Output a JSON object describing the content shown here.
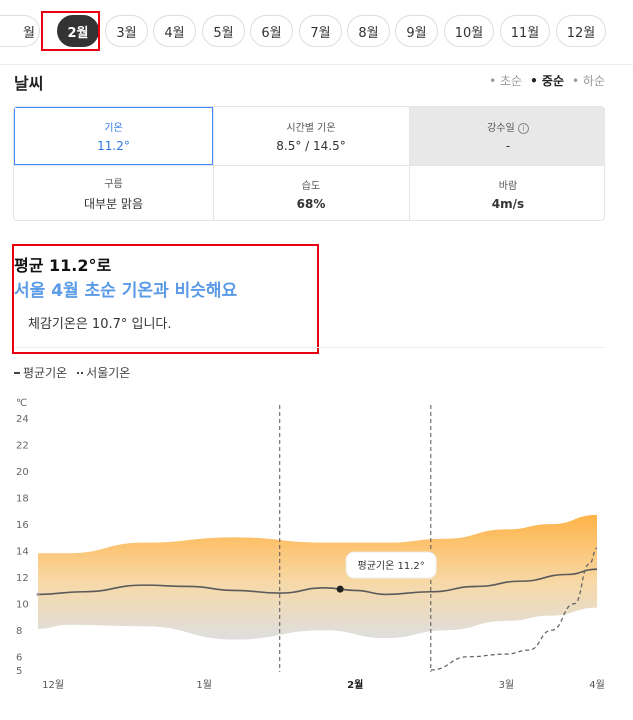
{
  "months": [
    {
      "label": "월",
      "active": false
    },
    {
      "label": "2월",
      "active": true
    },
    {
      "label": "3월",
      "active": false
    },
    {
      "label": "4월",
      "active": false
    },
    {
      "label": "5월",
      "active": false
    },
    {
      "label": "6월",
      "active": false
    },
    {
      "label": "7월",
      "active": false
    },
    {
      "label": "8월",
      "active": false
    },
    {
      "label": "9월",
      "active": false
    },
    {
      "label": "10월",
      "active": false
    },
    {
      "label": "11월",
      "active": false
    },
    {
      "label": "12월",
      "active": false
    }
  ],
  "section_title": "날씨",
  "time_filter": {
    "early": "• 초순",
    "mid": "• 중순",
    "late": "• 하순",
    "selected": "mid"
  },
  "weather": {
    "temp": {
      "label": "기온",
      "value": "11.2°"
    },
    "hourly": {
      "label": "시간별 기온",
      "value": "8.5° / 14.5°"
    },
    "rain_days": {
      "label": "강수일",
      "value": "-"
    },
    "cloud": {
      "label": "구름",
      "value": "대부분 맑음"
    },
    "humidity": {
      "label": "습도",
      "value": "68%"
    },
    "wind": {
      "label": "바람",
      "value": "4m/s"
    }
  },
  "summary": {
    "line1": "평균 11.2°로",
    "line2": "서울 4월 초순 기온과 비슷해요",
    "line3": "체감기온은 10.7° 입니다."
  },
  "legend": {
    "avg": "평균기온",
    "seoul": "서울기온"
  },
  "colors": {
    "accent": "#2e7ae5",
    "highlight_text": "#5a9ae6",
    "band_top": "#ffb347",
    "band_bottom": "#dcdcdc",
    "redbox": "#e60012"
  },
  "icons": {
    "prev": "chevron-left-icon",
    "info": "info-icon"
  },
  "chart_data": {
    "type": "area",
    "yunit": "℃",
    "yticks": [
      5,
      6,
      8,
      10,
      12,
      14,
      16,
      18,
      20,
      22,
      24
    ],
    "ylim": [
      5,
      24
    ],
    "xticks": [
      {
        "label": "12월",
        "x": 0,
        "strong": false
      },
      {
        "label": "1월",
        "x": 1,
        "strong": false
      },
      {
        "label": "2월",
        "x": 2,
        "strong": true
      },
      {
        "label": "3월",
        "x": 3,
        "strong": false
      },
      {
        "label": "4월",
        "x": 3.6,
        "strong": false
      }
    ],
    "xlim": [
      -0.1,
      3.6
    ],
    "band_x": [
      -0.1,
      0.1,
      0.6,
      1.2,
      1.8,
      2.2,
      2.6,
      3.0,
      3.3,
      3.6
    ],
    "band_high": [
      13.8,
      13.8,
      14.6,
      15.0,
      14.6,
      14.6,
      14.9,
      15.6,
      16.0,
      16.7
    ],
    "band_low": [
      8.1,
      8.4,
      8.3,
      7.3,
      8.0,
      7.4,
      8.0,
      8.7,
      9.1,
      9.7
    ],
    "series": [
      {
        "name": "평균기온",
        "style": "solid",
        "x": [
          -0.1,
          0.2,
          0.6,
          0.9,
          1.2,
          1.5,
          1.8,
          2.0,
          2.2,
          2.5,
          2.8,
          3.1,
          3.4,
          3.6
        ],
        "values": [
          10.7,
          10.9,
          11.4,
          11.3,
          11.0,
          10.8,
          11.2,
          11.0,
          10.7,
          10.9,
          11.3,
          11.7,
          12.2,
          12.6
        ]
      },
      {
        "name": "서울기온",
        "style": "dashed",
        "x": [
          2.5,
          2.75,
          3.0,
          3.15,
          3.3,
          3.45,
          3.55,
          3.6
        ],
        "values": [
          5.0,
          6.0,
          6.2,
          6.5,
          8.0,
          10.0,
          13.0,
          14.2
        ]
      }
    ],
    "markers": [
      {
        "x": -0.1,
        "label": ""
      },
      {
        "x": 1.9,
        "label": "평균기온 11.2°"
      }
    ],
    "vlines": [
      1.5,
      2.5
    ]
  }
}
